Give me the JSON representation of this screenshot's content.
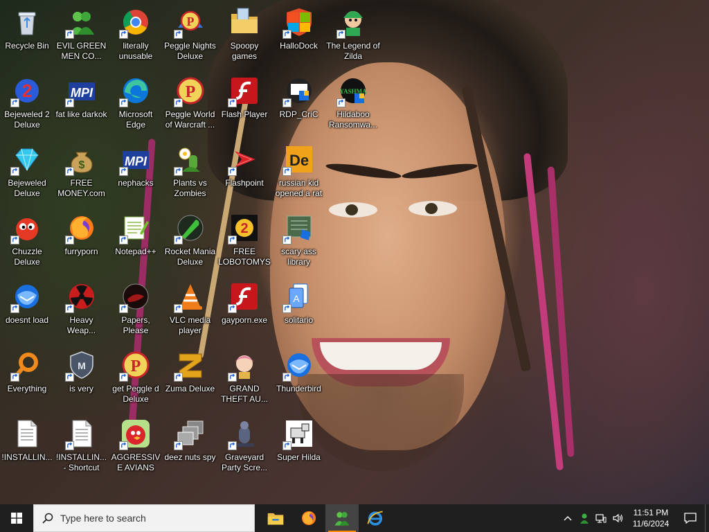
{
  "desktop": {
    "icons": [
      {
        "label": "Recycle Bin",
        "icon": "recycle-bin-icon",
        "shortcut": false
      },
      {
        "label": "Bejeweled 2 Deluxe",
        "icon": "bejeweled-2-icon",
        "shortcut": true
      },
      {
        "label": "Bejeweled Deluxe",
        "icon": "diamond-icon",
        "shortcut": true
      },
      {
        "label": "Chuzzle Deluxe",
        "icon": "chuzzle-icon",
        "shortcut": true
      },
      {
        "label": "doesnt load",
        "icon": "thunderbird-icon",
        "shortcut": true
      },
      {
        "label": "Everything",
        "icon": "everything-search-icon",
        "shortcut": true
      },
      {
        "label": "!INSTALLIN...",
        "icon": "text-file-icon",
        "shortcut": false
      },
      {
        "label": "EVIL GREEN MEN CO...",
        "icon": "green-men-icon",
        "shortcut": true
      },
      {
        "label": "fat like darkok",
        "icon": "mpi-icon",
        "shortcut": true
      },
      {
        "label": "FREE MONEY.com",
        "icon": "money-bag-icon",
        "shortcut": true
      },
      {
        "label": "furryporn",
        "icon": "firefox-icon",
        "shortcut": true
      },
      {
        "label": "Heavy Weap...",
        "icon": "radiation-icon",
        "shortcut": true
      },
      {
        "label": "is very",
        "icon": "shield-icon",
        "shortcut": true
      },
      {
        "label": "!INSTALLIN... - Shortcut",
        "icon": "text-file-icon",
        "shortcut": true
      },
      {
        "label": "literally unusable",
        "icon": "chrome-icon",
        "shortcut": true
      },
      {
        "label": "Microsoft Edge",
        "icon": "edge-icon",
        "shortcut": true
      },
      {
        "label": "nephacks",
        "icon": "mpi-icon",
        "shortcut": true
      },
      {
        "label": "Notepad++",
        "icon": "notepad-plus-icon",
        "shortcut": true
      },
      {
        "label": "Papers, Please",
        "icon": "papers-please-icon",
        "shortcut": true
      },
      {
        "label": "get Peggle d Deluxe",
        "icon": "peggle-icon",
        "shortcut": true
      },
      {
        "label": "AGGRESSIVE AVIANS",
        "icon": "angry-bird-icon",
        "shortcut": true
      },
      {
        "label": "Peggle Nights Deluxe",
        "icon": "peggle-nights-icon",
        "shortcut": true
      },
      {
        "label": "Peggle World of Warcraft ...",
        "icon": "peggle-icon",
        "shortcut": true
      },
      {
        "label": "Plants vs Zombies",
        "icon": "plants-icon",
        "shortcut": true
      },
      {
        "label": "Rocket Mania Deluxe",
        "icon": "rocket-icon",
        "shortcut": true
      },
      {
        "label": "VLC media player",
        "icon": "vlc-cone-icon",
        "shortcut": true
      },
      {
        "label": "Zuma Deluxe",
        "icon": "zuma-icon",
        "shortcut": true
      },
      {
        "label": "deez nuts spy",
        "icon": "stacked-windows-icon",
        "shortcut": true
      },
      {
        "label": "Spoopy games",
        "icon": "folder-icon",
        "shortcut": false
      },
      {
        "label": "Flash Player",
        "icon": "flash-icon",
        "shortcut": true
      },
      {
        "label": "Flashpoint",
        "icon": "flashpoint-icon",
        "shortcut": true
      },
      {
        "label": "FREE LOBOTOMYS",
        "icon": "lobotomy-icon",
        "shortcut": true
      },
      {
        "label": "gayporn.exe",
        "icon": "flash-icon",
        "shortcut": true
      },
      {
        "label": "GRAND THEFT AU...",
        "icon": "anime-girl-icon",
        "shortcut": true
      },
      {
        "label": "Graveyard Party Scre...",
        "icon": "graveyard-icon",
        "shortcut": true
      },
      {
        "label": "HalloDock",
        "icon": "windows-shield-icon",
        "shortcut": true
      },
      {
        "label": "RDP_CriC",
        "icon": "rdp-icon",
        "shortcut": true
      },
      {
        "label": "russian kid opened a rat",
        "icon": "de-icon",
        "shortcut": true
      },
      {
        "label": "scary ass library",
        "icon": "library-icon",
        "shortcut": true
      },
      {
        "label": "solitario",
        "icon": "solitaire-icon",
        "shortcut": true
      },
      {
        "label": "Thunderbird",
        "icon": "thunderbird-icon",
        "shortcut": true
      },
      {
        "label": "Super Hilda",
        "icon": "pixel-dog-icon",
        "shortcut": true
      },
      {
        "label": "The Legend of Zilda",
        "icon": "zilda-icon",
        "shortcut": true
      },
      {
        "label": "Hildaboo Ransomwa...",
        "icon": "yashma-icon",
        "shortcut": true
      }
    ]
  },
  "taskbar": {
    "search_placeholder": "Type here to search",
    "apps": [
      {
        "name": "file-explorer-icon",
        "active": false
      },
      {
        "name": "firefox-icon",
        "active": false
      },
      {
        "name": "green-men-icon",
        "active": true
      },
      {
        "name": "internet-explorer-icon",
        "active": false
      }
    ],
    "clock": {
      "time": "11:51 PM",
      "date": "11/6/2024"
    }
  }
}
